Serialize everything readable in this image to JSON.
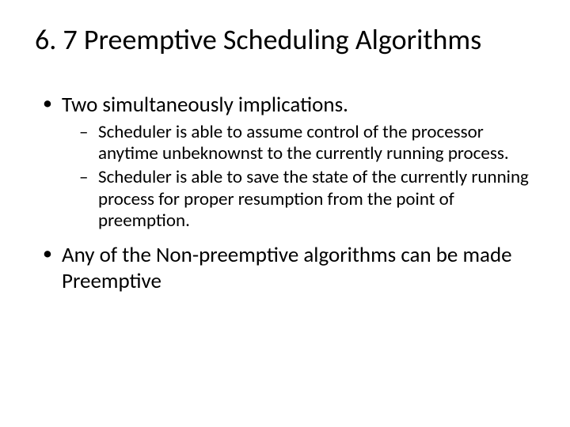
{
  "title": "6. 7 Preemptive Scheduling Algorithms",
  "bullets": {
    "b1": "Two simultaneously implications.",
    "b1a": "Scheduler is able to assume control of the processor anytime unbeknownst to the currently running process.",
    "b1b": "Scheduler is able to save the state of the currently running process for proper resumption from the point of preemption.",
    "b2": "Any of the Non-preemptive algorithms can be made Preemptive"
  }
}
